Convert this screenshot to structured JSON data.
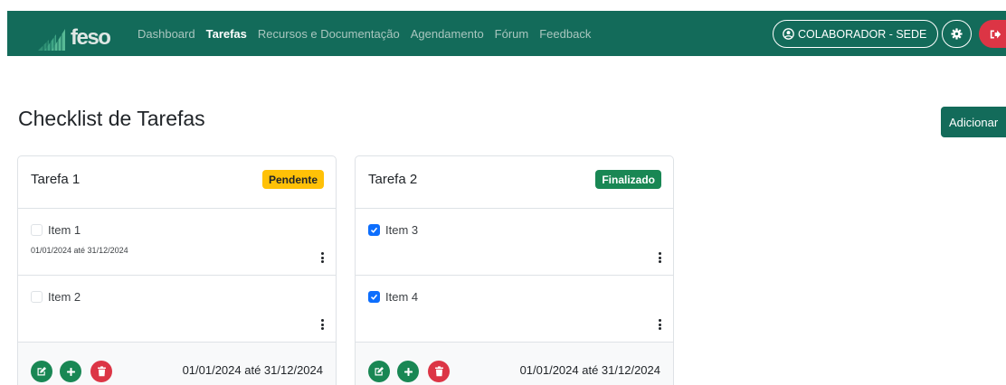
{
  "nav": {
    "brand": "feso",
    "links": [
      {
        "label": "Dashboard",
        "active": false
      },
      {
        "label": "Tarefas",
        "active": true
      },
      {
        "label": "Recursos e Documentação",
        "active": false
      },
      {
        "label": "Agendamento",
        "active": false
      },
      {
        "label": "Fórum",
        "active": false
      },
      {
        "label": "Feedback",
        "active": false
      }
    ],
    "role_label": "COLABORADOR - SEDE"
  },
  "page": {
    "title": "Checklist de Tarefas",
    "add_label": "Adicionar"
  },
  "tasks": [
    {
      "title": "Tarefa 1",
      "status": "Pendente",
      "items": [
        {
          "label": "Item 1",
          "checked": false,
          "dates": "01/01/2024 até 31/12/2024"
        },
        {
          "label": "Item 2",
          "checked": false,
          "dates": ""
        }
      ],
      "dates": "01/01/2024 até 31/12/2024"
    },
    {
      "title": "Tarefa 2",
      "status": "Finalizado",
      "items": [
        {
          "label": "Item 3",
          "checked": true,
          "dates": ""
        },
        {
          "label": "Item 4",
          "checked": true,
          "dates": ""
        }
      ],
      "dates": "01/01/2024 até 31/12/2024"
    }
  ],
  "colors": {
    "primary": "#136b5a",
    "success": "#198754",
    "warning": "#ffc107",
    "danger": "#dc3545",
    "checkbox": "#0d6efd"
  },
  "icons": {
    "logo": "feso-logo-icon",
    "role": "user-circle-icon",
    "settings": "gear-icon",
    "logout": "logout-icon",
    "edit": "edit-icon",
    "add": "plus-icon",
    "delete": "trash-icon",
    "menu": "kebab-menu-icon"
  }
}
